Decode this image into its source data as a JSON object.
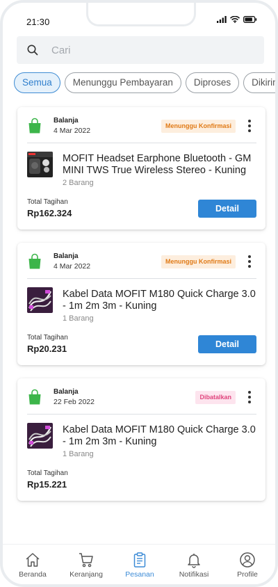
{
  "status_bar": {
    "time": "21:30"
  },
  "search": {
    "placeholder": "Cari",
    "icon": "search-icon"
  },
  "filter_tabs": [
    {
      "label": "Semua",
      "active": true
    },
    {
      "label": "Menunggu Pembayaran",
      "active": false
    },
    {
      "label": "Diproses",
      "active": false
    },
    {
      "label": "Dikirim",
      "active": false
    }
  ],
  "orders": [
    {
      "type": "Balanja",
      "date": "4 Mar 2022",
      "status": "Menunggu Konfirmasi",
      "status_colors": {
        "bg": "#fdeede",
        "fg": "#e07a16"
      },
      "product_name": "MOFIT Headset Earphone Bluetooth - GM MINI TWS True Wireless Stereo - Kuning",
      "quantity": "2 Barang",
      "total_label": "Total Tagihan",
      "total": "Rp162.324",
      "detail_label": "Detail"
    },
    {
      "type": "Balanja",
      "date": "4 Mar 2022",
      "status": "Menunggu Konfirmasi",
      "status_colors": {
        "bg": "#fdeede",
        "fg": "#e07a16"
      },
      "product_name": "Kabel Data MOFIT M180 Quick Charge 3.0 - 1m 2m 3m - Kuning",
      "quantity": "1 Barang",
      "total_label": "Total Tagihan",
      "total": "Rp20.231",
      "detail_label": "Detail"
    },
    {
      "type": "Balanja",
      "date": "22 Feb 2022",
      "status": "Dibatalkan",
      "status_colors": {
        "bg": "#fde4ee",
        "fg": "#e0457e"
      },
      "product_name": "Kabel Data MOFIT M180 Quick Charge 3.0 - 1m 2m 3m - Kuning",
      "quantity": "1 Barang",
      "total_label": "Total Tagihan",
      "total": "Rp15.221"
    }
  ],
  "bottom_nav": [
    {
      "label": "Beranda",
      "icon": "home-icon",
      "active": false
    },
    {
      "label": "Keranjang",
      "icon": "cart-icon",
      "active": false
    },
    {
      "label": "Pesanan",
      "icon": "clipboard-icon",
      "active": true
    },
    {
      "label": "Notifikasi",
      "icon": "bell-icon",
      "active": false
    },
    {
      "label": "Profile",
      "icon": "profile-icon",
      "active": false
    }
  ],
  "colors": {
    "accent": "#2f86d6",
    "bag_green": "#3cb54a",
    "chip_active_bg": "#e5f1fb",
    "chip_active_fg": "#2f7fcd"
  }
}
